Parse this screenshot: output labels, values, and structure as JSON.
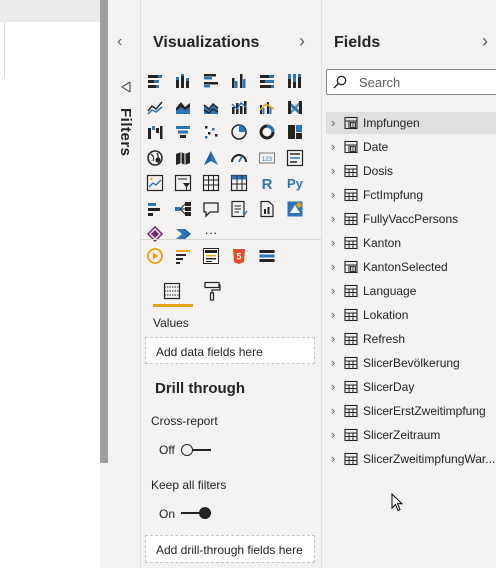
{
  "visualizations": {
    "title": "Visualizations",
    "values_label": "Values",
    "values_placeholder": "Add data fields here",
    "drill_title": "Drill through",
    "cross_report_label": "Cross-report",
    "cross_report_state": "Off",
    "keep_filters_label": "Keep all filters",
    "keep_filters_state": "On",
    "drill_placeholder": "Add drill-through fields here",
    "accent_color": "#e8a317",
    "icons": [
      "stacked-bar-icon",
      "stacked-column-icon",
      "clustered-bar-icon",
      "clustered-column-icon",
      "100-bar-icon",
      "100-column-icon",
      "line-chart-icon",
      "area-chart-icon",
      "stacked-area-icon",
      "line-column-icon",
      "line-clustered-column-icon",
      "ribbon-chart-icon",
      "waterfall-icon",
      "funnel-icon",
      "scatter-icon",
      "pie-icon",
      "donut-icon",
      "treemap-icon",
      "map-icon",
      "filled-map-icon",
      "azure-map-icon",
      "gauge-icon",
      "card-icon",
      "multirow-card-icon",
      "kpi-icon",
      "slicer-icon",
      "table-icon",
      "matrix-icon",
      "r-visual-icon",
      "python-visual-icon",
      "key-influencers-icon",
      "decomposition-tree-icon",
      "qna-icon",
      "smart-narrative-icon",
      "paginated-report-icon",
      "arcgis-icon",
      "power-apps-icon",
      "power-automate-icon",
      "more-visuals-icon"
    ],
    "custom_icons": [
      "play-axis-icon",
      "bullet-chart-icon",
      "barcode-icon",
      "html-icon",
      "list-visual-icon"
    ],
    "r_glyph": "R",
    "py_glyph": "Py",
    "more_glyph": "···",
    "html_glyph": "5"
  },
  "filters": {
    "label": "Filters"
  },
  "fields": {
    "title": "Fields",
    "search_placeholder": "Search",
    "tables": [
      {
        "name": "Impfungen",
        "icon": "calc-table-icon",
        "selected": true
      },
      {
        "name": "Date",
        "icon": "calc-table-icon"
      },
      {
        "name": "Dosis",
        "icon": "table-icon"
      },
      {
        "name": "FctImpfung",
        "icon": "table-icon"
      },
      {
        "name": "FullyVaccPersons",
        "icon": "table-icon"
      },
      {
        "name": "Kanton",
        "icon": "table-icon"
      },
      {
        "name": "KantonSelected",
        "icon": "calc-table-icon"
      },
      {
        "name": "Language",
        "icon": "table-icon"
      },
      {
        "name": "Lokation",
        "icon": "table-icon"
      },
      {
        "name": "Refresh",
        "icon": "table-icon"
      },
      {
        "name": "SlicerBevölkerung",
        "icon": "table-icon"
      },
      {
        "name": "SlicerDay",
        "icon": "table-icon"
      },
      {
        "name": "SlicerErstZweitimpfung",
        "icon": "table-icon"
      },
      {
        "name": "SlicerZeitraum",
        "icon": "table-icon"
      },
      {
        "name": "SlicerZweitimpfungWar...",
        "icon": "table-icon"
      }
    ]
  }
}
